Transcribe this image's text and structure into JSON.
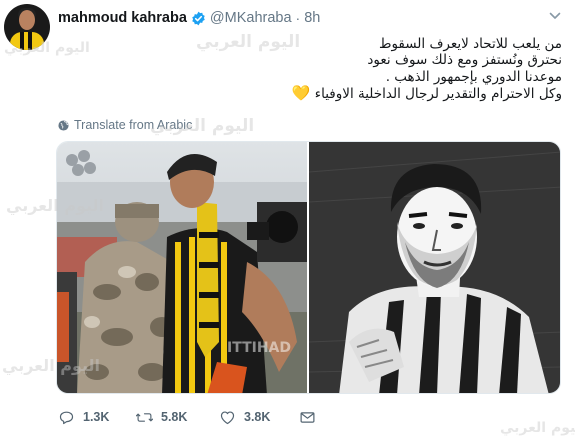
{
  "tweet": {
    "author_name": "mahmoud kahraba",
    "handle": "@MKahraba",
    "separator": "·",
    "time": "8h",
    "text_lines": [
      "من يلعب للاتحاد لايعرف السقوط",
      "نحترق ونُستفز ومع ذلك سوف نعود",
      "موعدنا الدوري بإجمهور الذهب .",
      "وكل الاحترام والتقدير لرجال الداخلية الاوفياء"
    ],
    "heart_emoji": "💛",
    "translate_label": "Translate from Arabic",
    "stats": {
      "replies": "1.3K",
      "retweets": "5.8K",
      "likes": "3.8K"
    }
  },
  "watermark": {
    "text": "اليوم العربي"
  },
  "icons": {
    "verified": "verified-badge-icon",
    "chevron": "chevron-down-icon",
    "globe": "globe-icon",
    "reply": "reply-icon",
    "retweet": "retweet-icon",
    "like": "heart-icon",
    "dm": "envelope-icon"
  },
  "colors": {
    "verified_blue": "#1da1f2",
    "secondary_text": "#657786",
    "jersey_yellow": "#f2c811"
  }
}
